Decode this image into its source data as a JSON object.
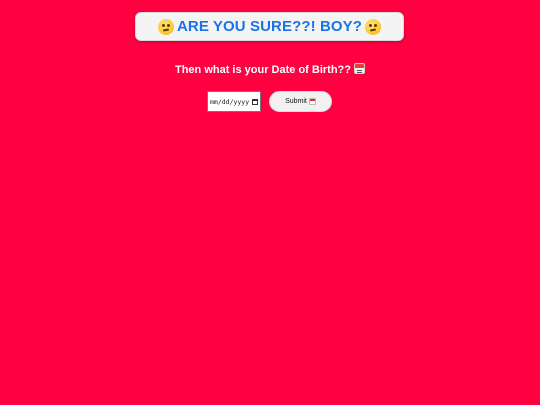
{
  "header": {
    "title": "ARE YOU SURE??! BOY?",
    "left_icon": "thinking-face-icon",
    "right_icon": "thinking-face-icon",
    "title_color": "#1a73e8"
  },
  "prompt": {
    "text": "Then what is your Date of Birth??",
    "icon": "calendar-icon"
  },
  "form": {
    "date_placeholder": "mm/dd/yyyy",
    "submit_label": "Submit",
    "submit_icon": "calendar-icon"
  },
  "colors": {
    "background": "#ff0040",
    "header_bg": "#f4f4f4",
    "text": "#ffffff"
  }
}
